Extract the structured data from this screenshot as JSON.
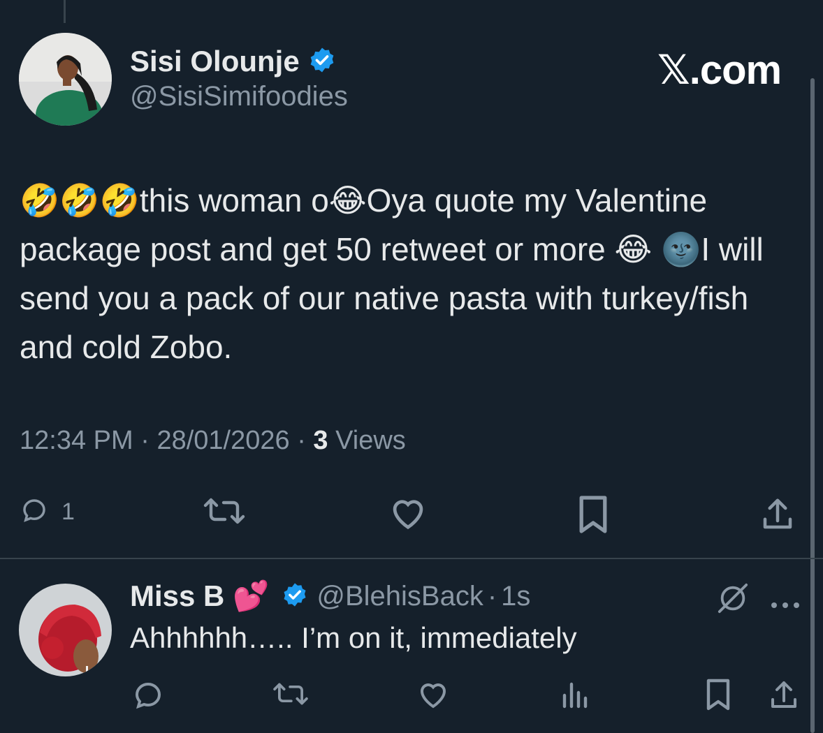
{
  "brand": {
    "logo_text": "𝕏.com"
  },
  "tweet": {
    "author": {
      "display_name": "Sisi Olounje",
      "handle": "@SisiSimifoodies",
      "verified": true
    },
    "text": "🤣🤣🤣this woman o😂Oya quote my Valentine package post and get 50 retweet  or more 😂 🌚I will send you a pack of our native pasta with turkey/fish and cold Zobo.",
    "time": "12:34 PM",
    "date": "28/01/2026",
    "views_count": "3",
    "views_label": "Views",
    "separator": "·",
    "reply_count": "1"
  },
  "reply": {
    "author": {
      "display_name": "Miss B 💕",
      "handle": "@BlehisBack",
      "age": "1s",
      "verified": true
    },
    "text": "Ahhhhhh….. I’m on it, immediately"
  },
  "icons": {
    "reply": "reply-icon",
    "retweet": "retweet-icon",
    "like": "heart-icon",
    "bookmark": "bookmark-icon",
    "share": "share-icon",
    "views": "analytics-icon",
    "grok": "grok-icon",
    "more": "more-dots-icon",
    "verified": "verified-badge-icon"
  },
  "colors": {
    "background": "#15202b",
    "text_primary": "#e7e9ea",
    "text_secondary": "#8b98a5",
    "verified_blue": "#1d9bf0",
    "divider": "#38444d"
  }
}
